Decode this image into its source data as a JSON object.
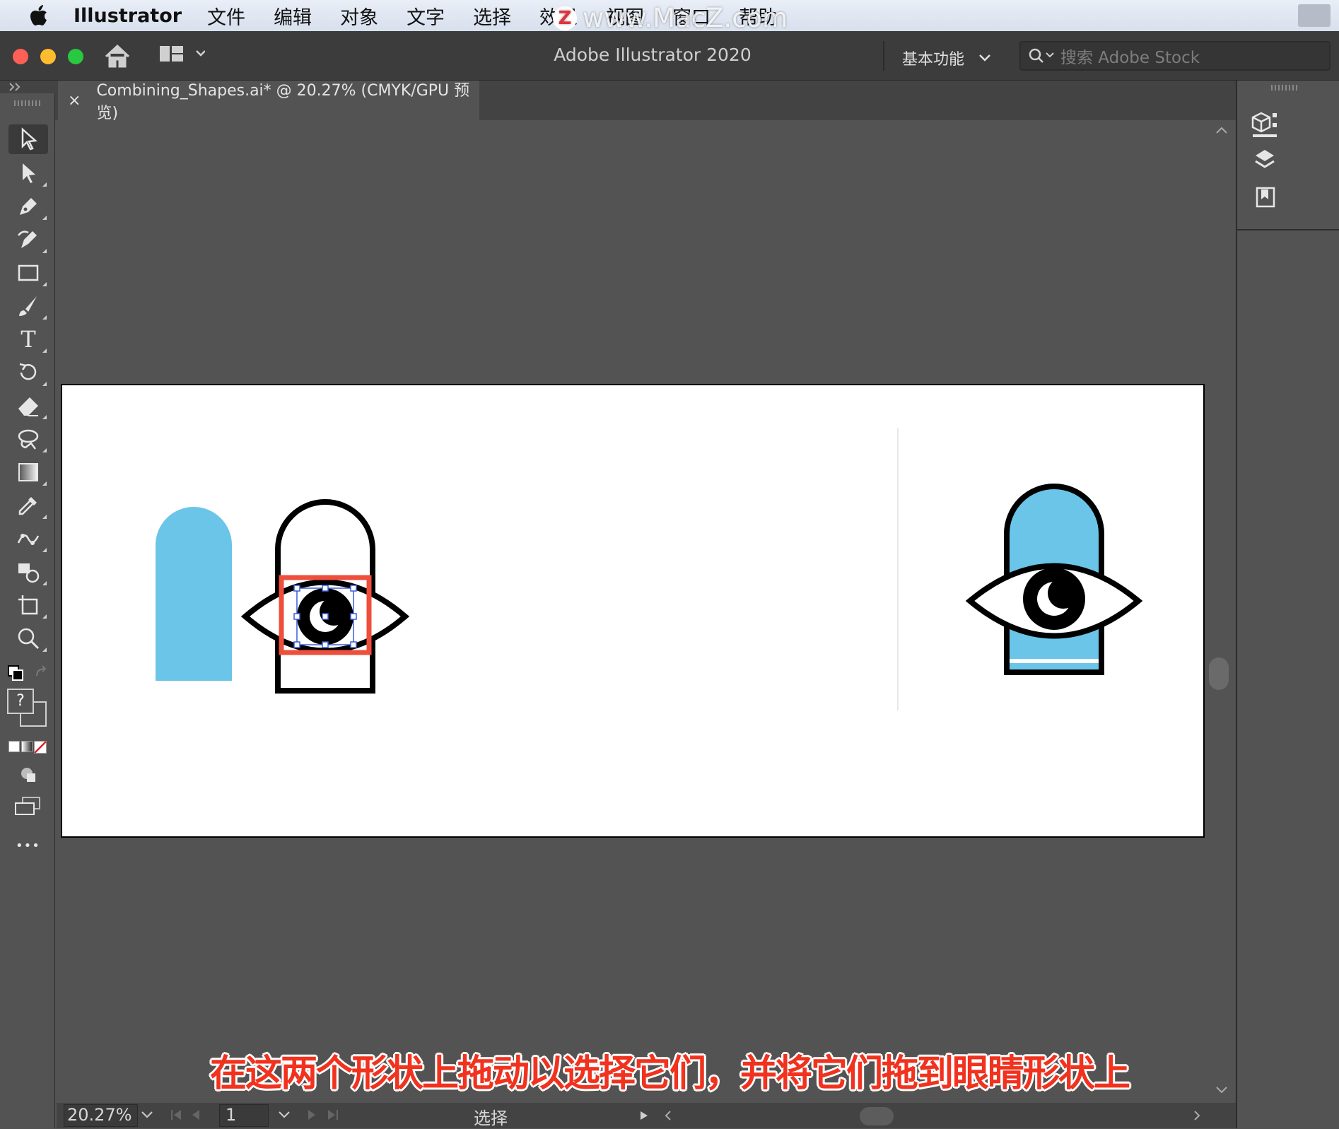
{
  "menubar": {
    "apple_icon": "apple-icon",
    "app_name": "Illustrator",
    "items": [
      "文件",
      "编辑",
      "对象",
      "文字",
      "选择",
      "效果",
      "视图",
      "窗口",
      "帮助"
    ]
  },
  "watermark": {
    "logo": "Z",
    "text": "www.MacZ.com"
  },
  "titlebar": {
    "title": "Adobe Illustrator 2020",
    "workspace": "基本功能",
    "search_placeholder": "搜索 Adobe Stock"
  },
  "document_tab": {
    "title": "Combining_Shapes.ai* @ 20.27% (CMYK/GPU 预览)",
    "close": "×"
  },
  "toolbox": {
    "tools": [
      "selection-tool",
      "direct-selection-tool",
      "pen-tool",
      "curvature-tool",
      "rectangle-tool",
      "paintbrush-tool",
      "type-tool",
      "rotate-tool",
      "eraser-tool",
      "lasso-tool",
      "gradient-tool",
      "eyedropper-tool",
      "puppet-warp-tool",
      "shape-builder-tool",
      "artboard-tool",
      "zoom-tool"
    ],
    "type_glyph": "T",
    "unknown_glyph": "?",
    "more": "•••"
  },
  "statusbar": {
    "zoom": "20.27%",
    "page": "1",
    "current_tool": "选择"
  },
  "caption": "在这两个形状上拖动以选择它们，并将它们拖到眼睛形状上",
  "colors": {
    "accent_blue": "#6ac5e8",
    "highlight_red": "#ee4f3c"
  }
}
